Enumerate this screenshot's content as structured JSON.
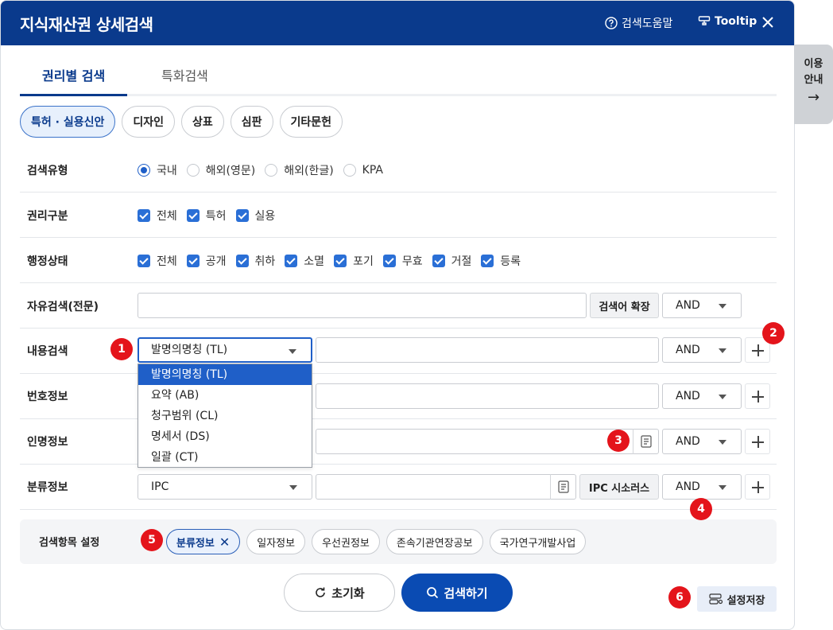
{
  "header": {
    "title": "지식재산권 상세검색",
    "help_label": "검색도움말",
    "tooltip_label": "Tooltip"
  },
  "side_tab": {
    "line1": "이용",
    "line2": "안내"
  },
  "tabs": [
    {
      "label": "권리별 검색",
      "active": true
    },
    {
      "label": "특화검색",
      "active": false
    }
  ],
  "categories": [
    "특허 · 실용신안",
    "디자인",
    "상표",
    "심판",
    "기타문헌"
  ],
  "search_type": {
    "label": "검색유형",
    "options": [
      "국내",
      "해외(영문)",
      "해외(한글)",
      "KPA"
    ],
    "selected": "국내"
  },
  "rights": {
    "label": "권리구분",
    "options": [
      "전체",
      "특허",
      "실용"
    ]
  },
  "admin_status": {
    "label": "행정상태",
    "options": [
      "전체",
      "공개",
      "취하",
      "소멸",
      "포기",
      "무효",
      "거절",
      "등록"
    ]
  },
  "free_search": {
    "label": "자유검색(전문)",
    "expand_button": "검색어 확장",
    "operator": "AND"
  },
  "content_search": {
    "label": "내용검색",
    "field": "발명의명칭 (TL)",
    "operator": "AND"
  },
  "number_info": {
    "label": "번호정보",
    "operator": "AND"
  },
  "person_info": {
    "label": "인명정보",
    "operator": "AND"
  },
  "class_info": {
    "label": "분류정보",
    "field": "IPC",
    "thesaurus_button": "IPC 시소러스",
    "operator": "AND"
  },
  "dropdown_options": [
    "발명의명칭 (TL)",
    "요약 (AB)",
    "청구범위 (CL)",
    "명세서 (DS)",
    "일괄 (CT)"
  ],
  "settings": {
    "label": "검색항목 설정",
    "chips": [
      "분류정보",
      "일자정보",
      "우선권정보",
      "존속기관연장공보",
      "국가연구개발사업"
    ]
  },
  "actions": {
    "reset": "초기화",
    "search": "검색하기",
    "save": "설정저장"
  },
  "badges": [
    "1",
    "2",
    "3",
    "4",
    "5",
    "6"
  ],
  "colors": {
    "primary": "#0a3a8c",
    "accent": "#1f5fc8",
    "badge": "#e4141b"
  }
}
